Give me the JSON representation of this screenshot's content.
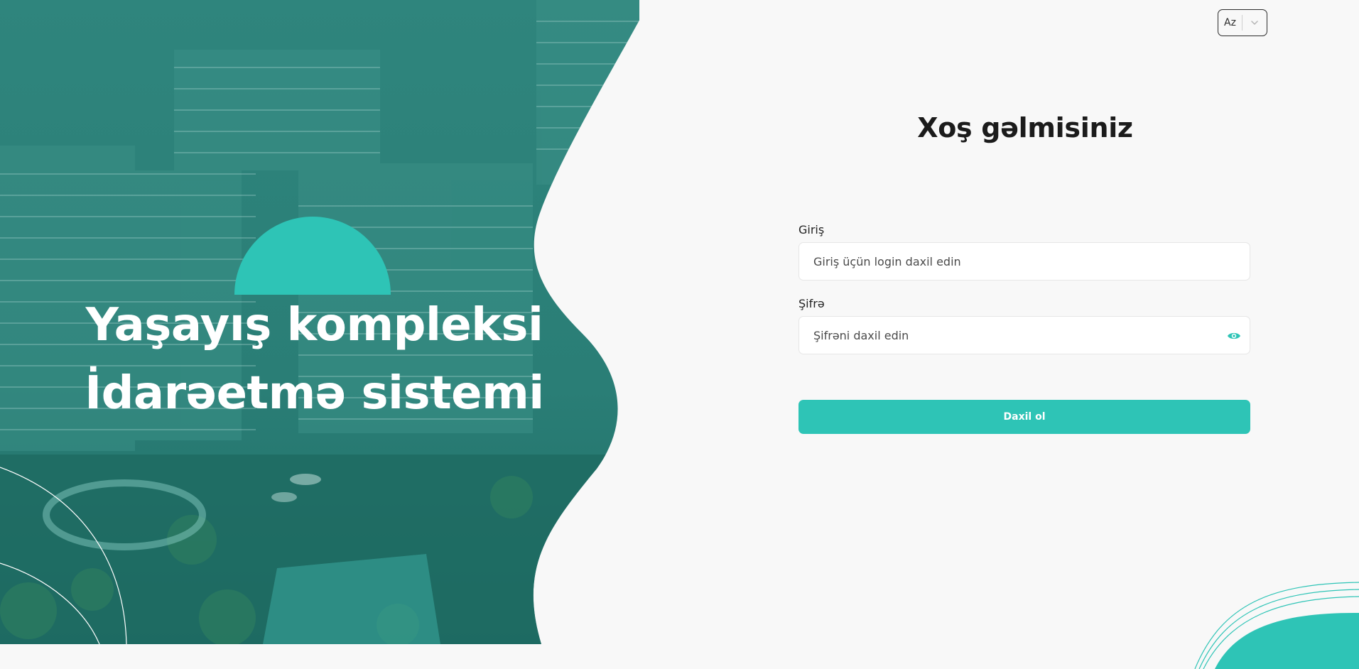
{
  "hero": {
    "title_line1": "Yaşayış kompleksi",
    "title_line2": "İdarəetmə sistemi"
  },
  "language": {
    "selected": "Az",
    "icon": "chevron-down-icon"
  },
  "login": {
    "title": "Xoş gəlmisiniz",
    "username": {
      "label": "Giriş",
      "placeholder": "Giriş üçün login daxil edin",
      "value": ""
    },
    "password": {
      "label": "Şifrə",
      "placeholder": "Şifrəni daxil edin",
      "value": "",
      "toggle_icon": "eye-icon"
    },
    "submit_label": "Daxil ol"
  },
  "colors": {
    "accent": "#2ec4b6",
    "hero_overlay": "#2a7f78",
    "background": "#f8f8f8",
    "text": "#1b1b1b"
  }
}
